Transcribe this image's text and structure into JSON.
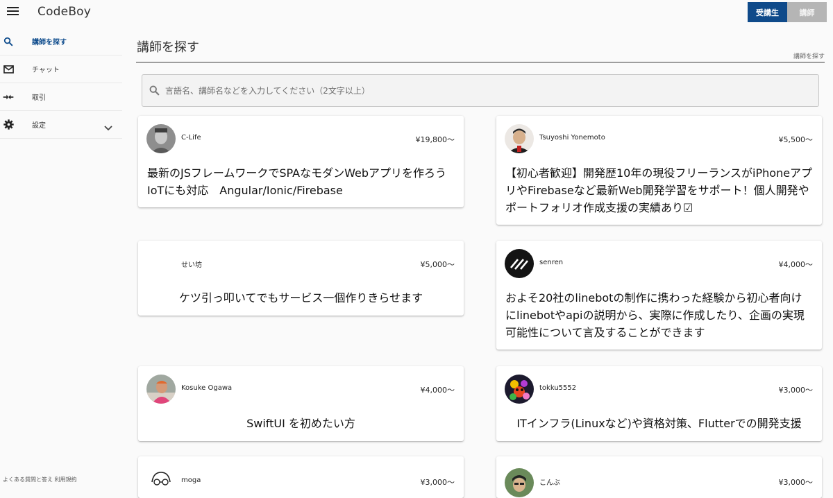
{
  "header": {
    "app_title": "CodeBoy",
    "role_student": "受講生",
    "role_teacher": "講師"
  },
  "sidebar": {
    "items": [
      {
        "label": "講師を探す",
        "icon": "search-icon"
      },
      {
        "label": "チャット",
        "icon": "mail-icon"
      },
      {
        "label": "取引",
        "icon": "swap-icon"
      },
      {
        "label": "設定",
        "icon": "gear-icon"
      }
    ],
    "footer": "よくある質問と答え  利用規約"
  },
  "main": {
    "page_title": "講師を探す",
    "breadcrumb": "講師を探す",
    "search_placeholder": "言語名、講師名などを入力してください（2文字以上）"
  },
  "cards": [
    {
      "name": "C-Life",
      "price": "¥19,800〜",
      "title": "最新のJSフレームワークでSPAなモダンWebアプリを作ろう　IoTにも対応　Angular/Ionic/Firebase"
    },
    {
      "name": "Tsuyoshi Yonemoto",
      "price": "¥5,500〜",
      "title": "【初心者歓迎】開発歴10年の現役フリーランスがiPhoneアプリやFirebaseなど最新Web開発学習をサポート！個人開発やポートフォリオ作成支援の実績あり☑"
    },
    {
      "name": "せい坊",
      "price": "¥5,000〜",
      "title": "ケツ引っ叩いてでもサービス一個作りきらせます"
    },
    {
      "name": "senren",
      "price": "¥4,000〜",
      "title": "およそ20社のlinebotの制作に携わった経験から初心者向けにlinebotやapiの説明から、実際に作成したり、企画の実現可能性について言及することができます"
    },
    {
      "name": "Kosuke Ogawa",
      "price": "¥4,000〜",
      "title": "SwiftUI を初めたい方"
    },
    {
      "name": "tokku5552",
      "price": "¥3,000〜",
      "title": "ITインフラ(Linuxなど)や資格対策、Flutterでの開発支援"
    },
    {
      "name": "moga",
      "price": "¥3,000〜",
      "title": ""
    },
    {
      "name": "こんぶ",
      "price": "¥3,000〜",
      "title": ""
    }
  ],
  "colors": {
    "accent": "#0d4b8c",
    "role_active": "#0f4a8a",
    "role_inactive": "#b5b5b5"
  }
}
